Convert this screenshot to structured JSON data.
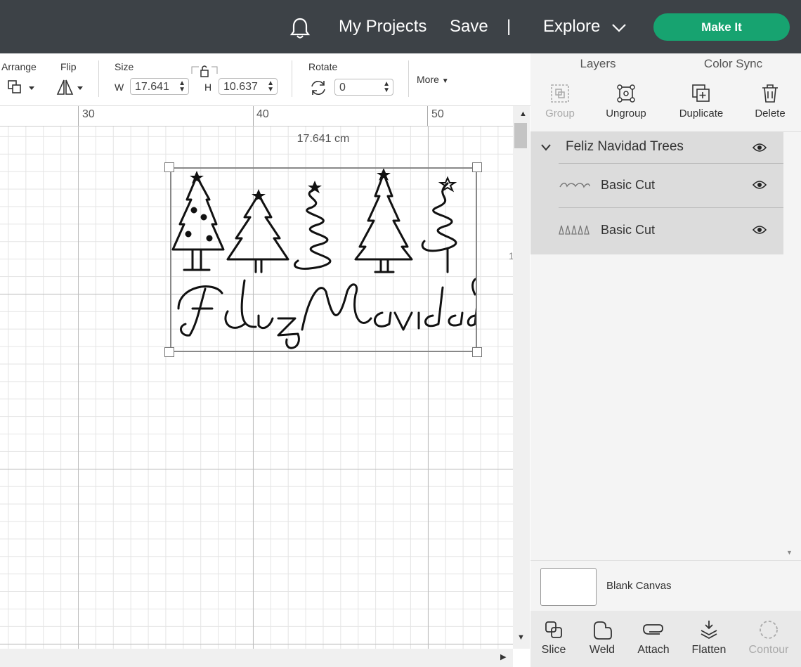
{
  "topbar": {
    "my_projects": "My Projects",
    "save": "Save",
    "separator": "|",
    "explore": "Explore",
    "make_it": "Make It"
  },
  "toolbar": {
    "arrange": "Arrange",
    "flip": "Flip",
    "size": "Size",
    "w_label": "W",
    "w_value": "17.641",
    "h_label": "H",
    "h_value": "10.637",
    "rotate": "Rotate",
    "rotate_value": "0",
    "more": "More"
  },
  "ruler": {
    "marks": [
      "30",
      "40",
      "50"
    ],
    "partial": "1"
  },
  "canvas": {
    "dimension_label": "17.641 cm",
    "design_text": "Feliz Navidad"
  },
  "panel": {
    "tabs": [
      "Layers",
      "Color Sync"
    ],
    "active_tab": "Layers",
    "tools": [
      "Group",
      "Ungroup",
      "Duplicate",
      "Delete"
    ],
    "group_name": "Feliz Navidad Trees",
    "layers": [
      {
        "name": "Basic Cut"
      },
      {
        "name": "Basic Cut"
      }
    ],
    "blank_canvas": "Blank Canvas",
    "bottom_tools": [
      "Slice",
      "Weld",
      "Attach",
      "Flatten",
      "Contour"
    ]
  },
  "colors": {
    "topbar": "#3d4247",
    "make_it": "#17a370",
    "disabled": "#aaaaaa"
  }
}
